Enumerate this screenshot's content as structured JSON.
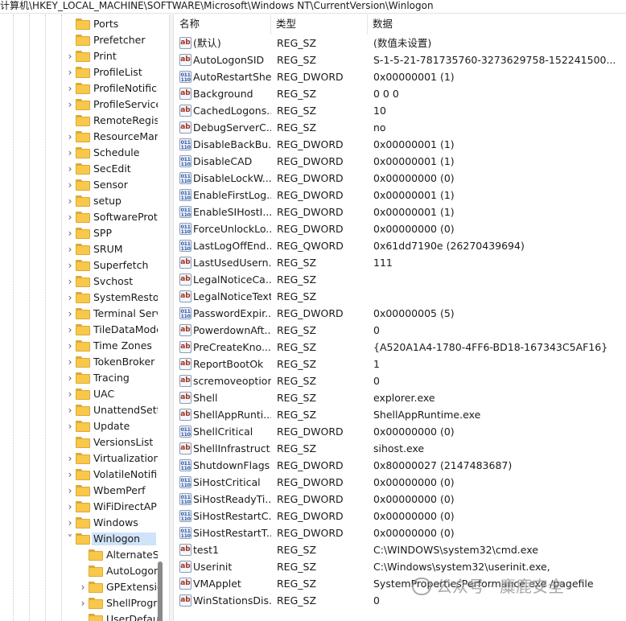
{
  "address_path": "计算机\\HKEY_LOCAL_MACHINE\\SOFTWARE\\Microsoft\\Windows NT\\CurrentVersion\\Winlogon",
  "tree": {
    "items": [
      {
        "label": "Ports",
        "expandable": false,
        "level": 1
      },
      {
        "label": "Prefetcher",
        "expandable": false,
        "level": 1
      },
      {
        "label": "Print",
        "expandable": true,
        "level": 1
      },
      {
        "label": "ProfileList",
        "expandable": true,
        "level": 1
      },
      {
        "label": "ProfileNotifica",
        "expandable": true,
        "level": 1
      },
      {
        "label": "ProfileService",
        "expandable": true,
        "level": 1
      },
      {
        "label": "RemoteRegis",
        "expandable": false,
        "level": 1
      },
      {
        "label": "ResourceMar",
        "expandable": true,
        "level": 1
      },
      {
        "label": "Schedule",
        "expandable": true,
        "level": 1
      },
      {
        "label": "SecEdit",
        "expandable": true,
        "level": 1
      },
      {
        "label": "Sensor",
        "expandable": true,
        "level": 1
      },
      {
        "label": "setup",
        "expandable": true,
        "level": 1
      },
      {
        "label": "SoftwareProte",
        "expandable": true,
        "level": 1
      },
      {
        "label": "SPP",
        "expandable": true,
        "level": 1
      },
      {
        "label": "SRUM",
        "expandable": true,
        "level": 1
      },
      {
        "label": "Superfetch",
        "expandable": true,
        "level": 1
      },
      {
        "label": "Svchost",
        "expandable": true,
        "level": 1
      },
      {
        "label": "SystemRestor",
        "expandable": true,
        "level": 1
      },
      {
        "label": "Terminal Serv",
        "expandable": true,
        "level": 1
      },
      {
        "label": "TileDataMode",
        "expandable": true,
        "level": 1
      },
      {
        "label": "Time Zones",
        "expandable": true,
        "level": 1
      },
      {
        "label": "TokenBroker",
        "expandable": true,
        "level": 1
      },
      {
        "label": "Tracing",
        "expandable": true,
        "level": 1
      },
      {
        "label": "UAC",
        "expandable": true,
        "level": 1
      },
      {
        "label": "UnattendSetti",
        "expandable": true,
        "level": 1
      },
      {
        "label": "Update",
        "expandable": true,
        "level": 1
      },
      {
        "label": "VersionsList",
        "expandable": false,
        "level": 1
      },
      {
        "label": "Virtualization",
        "expandable": true,
        "level": 1
      },
      {
        "label": "VolatileNotific",
        "expandable": true,
        "level": 1
      },
      {
        "label": "WbemPerf",
        "expandable": true,
        "level": 1
      },
      {
        "label": "WiFiDirectAPI",
        "expandable": true,
        "level": 1
      },
      {
        "label": "Windows",
        "expandable": true,
        "level": 1
      },
      {
        "label": "Winlogon",
        "expandable": true,
        "expanded": true,
        "selected": true,
        "level": 1
      },
      {
        "label": "AlternateSh",
        "expandable": false,
        "level": 2
      },
      {
        "label": "AutoLogon",
        "expandable": false,
        "level": 2
      },
      {
        "label": "GPExtensio",
        "expandable": true,
        "level": 2
      },
      {
        "label": "ShellProgr",
        "expandable": true,
        "level": 2
      },
      {
        "label": "UserDefau",
        "expandable": false,
        "level": 2
      }
    ]
  },
  "columns": {
    "name": "名称",
    "type": "类型",
    "data": "数据"
  },
  "values": [
    {
      "icon": "string",
      "name": "(默认)",
      "type": "REG_SZ",
      "data": "(数值未设置)"
    },
    {
      "icon": "string",
      "name": "AutoLogonSID",
      "type": "REG_SZ",
      "data": "S-1-5-21-781735760-3273629758-152241500..."
    },
    {
      "icon": "binary",
      "name": "AutoRestartShell",
      "type": "REG_DWORD",
      "data": "0x00000001 (1)"
    },
    {
      "icon": "string",
      "name": "Background",
      "type": "REG_SZ",
      "data": "0 0 0"
    },
    {
      "icon": "string",
      "name": "CachedLogons...",
      "type": "REG_SZ",
      "data": "10"
    },
    {
      "icon": "string",
      "name": "DebugServerC...",
      "type": "REG_SZ",
      "data": "no"
    },
    {
      "icon": "binary",
      "name": "DisableBackBu...",
      "type": "REG_DWORD",
      "data": "0x00000001 (1)"
    },
    {
      "icon": "binary",
      "name": "DisableCAD",
      "type": "REG_DWORD",
      "data": "0x00000001 (1)"
    },
    {
      "icon": "binary",
      "name": "DisableLockW...",
      "type": "REG_DWORD",
      "data": "0x00000000 (0)"
    },
    {
      "icon": "binary",
      "name": "EnableFirstLog...",
      "type": "REG_DWORD",
      "data": "0x00000001 (1)"
    },
    {
      "icon": "binary",
      "name": "EnableSIHostI...",
      "type": "REG_DWORD",
      "data": "0x00000001 (1)"
    },
    {
      "icon": "binary",
      "name": "ForceUnlockLo...",
      "type": "REG_DWORD",
      "data": "0x00000000 (0)"
    },
    {
      "icon": "binary",
      "name": "LastLogOffEnd...",
      "type": "REG_QWORD",
      "data": "0x61dd7190e (26270439694)"
    },
    {
      "icon": "string",
      "name": "LastUsedUsern...",
      "type": "REG_SZ",
      "data": "111"
    },
    {
      "icon": "string",
      "name": "LegalNoticeCa...",
      "type": "REG_SZ",
      "data": ""
    },
    {
      "icon": "string",
      "name": "LegalNoticeText",
      "type": "REG_SZ",
      "data": ""
    },
    {
      "icon": "binary",
      "name": "PasswordExpir...",
      "type": "REG_DWORD",
      "data": "0x00000005 (5)"
    },
    {
      "icon": "string",
      "name": "PowerdownAft...",
      "type": "REG_SZ",
      "data": "0"
    },
    {
      "icon": "string",
      "name": "PreCreateKno...",
      "type": "REG_SZ",
      "data": "{A520A1A4-1780-4FF6-BD18-167343C5AF16}"
    },
    {
      "icon": "string",
      "name": "ReportBootOk",
      "type": "REG_SZ",
      "data": "1"
    },
    {
      "icon": "string",
      "name": "scremoveoption",
      "type": "REG_SZ",
      "data": "0"
    },
    {
      "icon": "string",
      "name": "Shell",
      "type": "REG_SZ",
      "data": "explorer.exe"
    },
    {
      "icon": "string",
      "name": "ShellAppRunti...",
      "type": "REG_SZ",
      "data": "ShellAppRuntime.exe"
    },
    {
      "icon": "binary",
      "name": "ShellCritical",
      "type": "REG_DWORD",
      "data": "0x00000000 (0)"
    },
    {
      "icon": "string",
      "name": "ShellInfrastruct...",
      "type": "REG_SZ",
      "data": "sihost.exe"
    },
    {
      "icon": "binary",
      "name": "ShutdownFlags",
      "type": "REG_DWORD",
      "data": "0x80000027 (2147483687)"
    },
    {
      "icon": "binary",
      "name": "SiHostCritical",
      "type": "REG_DWORD",
      "data": "0x00000000 (0)"
    },
    {
      "icon": "binary",
      "name": "SiHostReadyTi...",
      "type": "REG_DWORD",
      "data": "0x00000000 (0)"
    },
    {
      "icon": "binary",
      "name": "SiHostRestartC...",
      "type": "REG_DWORD",
      "data": "0x00000000 (0)"
    },
    {
      "icon": "binary",
      "name": "SiHostRestartT...",
      "type": "REG_DWORD",
      "data": "0x00000000 (0)"
    },
    {
      "icon": "string",
      "name": "test1",
      "type": "REG_SZ",
      "data": "C:\\WINDOWS\\system32\\cmd.exe"
    },
    {
      "icon": "string",
      "name": "Userinit",
      "type": "REG_SZ",
      "data": "C:\\Windows\\system32\\userinit.exe,"
    },
    {
      "icon": "string",
      "name": "VMApplet",
      "type": "REG_SZ",
      "data": "SystemPropertiesPerformance.exe /pagefile"
    },
    {
      "icon": "string",
      "name": "WinStationsDis...",
      "type": "REG_SZ",
      "data": "0"
    }
  ],
  "watermark": "公众号 · 麋鹿安全"
}
